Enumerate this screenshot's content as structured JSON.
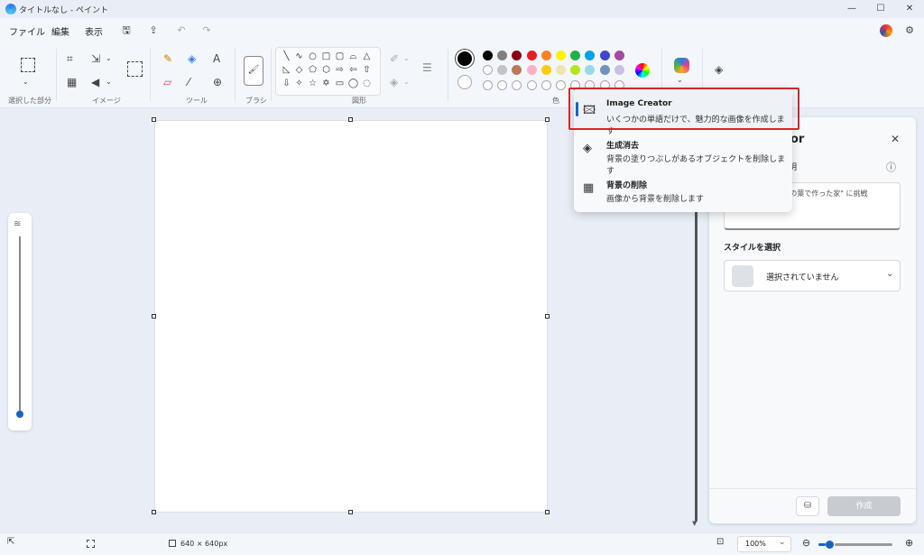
{
  "window": {
    "title": "タイトルなし - ペイント",
    "minimize": "—",
    "maximize": "☐",
    "close": "✕"
  },
  "menu": {
    "file": "ファイル",
    "edit": "編集",
    "view": "表示"
  },
  "ribbon": {
    "groups": {
      "selection": "選択した部分",
      "image": "イメージ",
      "tools": "ツール",
      "brush": "ブラシ",
      "shapes": "図形",
      "colors": "色"
    },
    "palette_row1": [
      "#000000",
      "#7f7f7f",
      "#880015",
      "#ed1c24",
      "#ff7f27",
      "#fff200",
      "#22b14c",
      "#00a2e8",
      "#3f48cc",
      "#a349a4"
    ],
    "palette_row2": [
      "#ffffff",
      "#c3c3c3",
      "#b97a57",
      "#ffaec9",
      "#ffc90e",
      "#efe4b0",
      "#b5e61d",
      "#99d9ea",
      "#7092be",
      "#c8bfe7"
    ]
  },
  "popup": {
    "items": [
      {
        "title": "Image Creator",
        "desc": "いくつかの単語だけで、魅力的な画像を作成します"
      },
      {
        "title": "生成消去",
        "desc": "背景の塗りつぶしがあるオブジェクトを削除します"
      },
      {
        "title": "背景の削除",
        "desc": "画像から背景を削除します"
      }
    ]
  },
  "panel": {
    "title_fragment": "or",
    "desc_fragment": "明",
    "prompt_fragment": "や \"木の葉で作った家\" に挑戦",
    "style_label": "スタイルを選択",
    "style_value": "選択されていません",
    "create_button": "作成",
    "close": "✕",
    "info": "ⓘ"
  },
  "status": {
    "canvas_size": "640 × 640px",
    "zoom": "100%",
    "zoom_level": 0.5
  }
}
